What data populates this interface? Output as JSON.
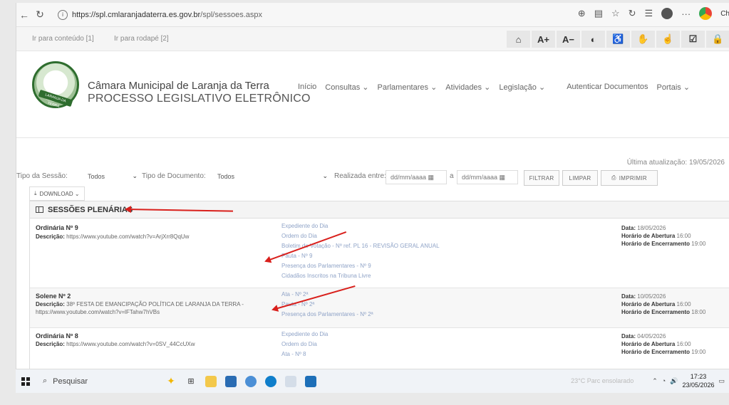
{
  "browser": {
    "url_domain": "https://spl.cmlaranjadaterra.es.gov.br",
    "url_path": "/spl/sessoes.aspx",
    "profile_label": "Ch"
  },
  "accessibility": {
    "skip_content": "Ir para conteúdo [1]",
    "skip_footer": "Ir para rodapé [2]",
    "buttons": [
      "home-icon",
      "A+",
      "A−",
      "contrast-icon",
      "accessibility-icon",
      "sign-language-icon",
      "hand-icon",
      "checkbox-icon",
      "lock-icon"
    ],
    "font_increase": "A+",
    "font_decrease": "A−"
  },
  "header": {
    "institution": "Câmara Municipal de Laranja da Terra",
    "subtitle": "PROCESSO LEGISLATIVO ELETRÔNICO",
    "logo_text": "LARANJA DA TERRA",
    "nav": [
      "Início",
      "Consultas ⌄",
      "Parlamentares ⌄",
      "Atividades ⌄",
      "Legislação ⌄",
      "Autenticar Documentos",
      "Portais ⌄"
    ]
  },
  "filters": {
    "updated": "Última atualização: 19/05/2026",
    "tipo_sessao_label": "Tipo da Sessão:",
    "tipo_sessao_value": "Todos",
    "tipo_doc_label": "Tipo de Documento:",
    "tipo_doc_value": "Todos",
    "realizado_label": "Realizada entre:",
    "date_placeholder": "dd/mm/aaaa",
    "and_label": "a",
    "filter_btn": "FILTRAR",
    "clear_btn": "LIMPAR",
    "print_btn": "IMPRIMIR",
    "download_btn": "DOWNLOAD ⌄"
  },
  "panel": {
    "title": "SESSÕES PLENÁRIAS",
    "sessions": [
      {
        "title": "Ordinária Nº 9",
        "desc_label": "Descrição:",
        "desc": "https://www.youtube.com/watch?v=ArjXrr8QqUw",
        "links": [
          "Expediente do Dia",
          "Ordem do Dia",
          "Boletim de Votação - Nº ref. PL 16 - REVISÃO GERAL ANUAL",
          "Pauta - Nº 9",
          "Presença dos Parlamentares - Nº 9",
          "Cidadãos Inscritos na Tribuna Livre"
        ],
        "date_label": "Data:",
        "date": "18/05/2026",
        "open_label": "Horário de Abertura",
        "open": "16:00",
        "close_label": "Horário de Encerramento",
        "close": "19:00"
      },
      {
        "title": "Solene Nº 2",
        "desc_label": "Descrição:",
        "desc": "38º FESTA DE EMANCIPAÇÃO POLÍTICA DE LARANJA DA TERRA - https://www.youtube.com/watch?v=lFTahw7hVBs",
        "links": [
          "Ata - Nº 2ª",
          "Pauta - Nº 2ª",
          "Presença dos Parlamentares - Nº 2ª"
        ],
        "date_label": "Data:",
        "date": "10/05/2026",
        "open_label": "Horário de Abertura",
        "open": "16:00",
        "close_label": "Horário de Encerramento",
        "close": "18:00"
      },
      {
        "title": "Ordinária Nº 8",
        "desc_label": "Descrição:",
        "desc": "https://www.youtube.com/watch?v=0SV_44CcUXw",
        "links": [
          "Expediente do Dia",
          "Ordem do Dia",
          "Ata - Nº 8"
        ],
        "date_label": "Data:",
        "date": "04/05/2026",
        "open_label": "Horário de Abertura",
        "open": "16:00",
        "close_label": "Horário de Encerramento",
        "close": "19:00"
      }
    ]
  },
  "taskbar": {
    "search_placeholder": "Pesquisar",
    "weather": "23°C  Parc ensolarado",
    "time": "17:23",
    "date": "23/05/2026"
  },
  "colors": {
    "annotation_arrow": "#d9201c",
    "link": "#8fa3c7",
    "logo_green": "#2e6d2e"
  }
}
